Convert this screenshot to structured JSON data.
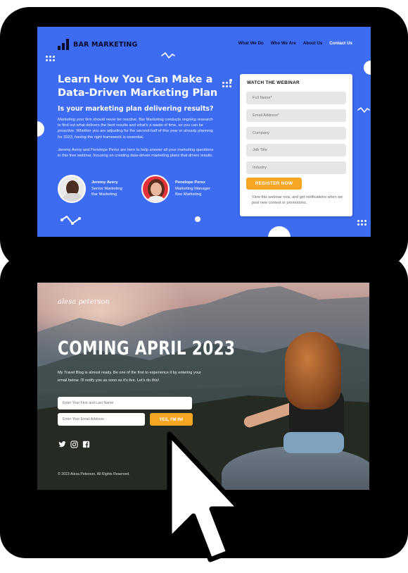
{
  "webinar": {
    "brand": "BAR MARKETING",
    "nav": [
      "What We Do",
      "Who We Are",
      "About Us",
      "Contact Us"
    ],
    "headline": "Learn How You Can Make a Data-Driven Marketing Plan",
    "subheadline": "Is your marketing plan delivering results?",
    "paragraph_1": "Marketing your firm should never be reactive. Bar Marketing conducts ongoing research to find out what delivers the best results and what's a waste of time, so you can be proactive. Whether you are adjusting for the second-half of this year or already planning for 2023, having the right framework is essential.",
    "paragraph_2": "Jeremy Avery and Penelope Perez are here to help answer all your marketing questions in this free webinar, focusing on creating data-driven marketing plans that drives results.",
    "speakers": [
      {
        "name": "Jeremy Avery",
        "role": "Senior Marketing",
        "company": "Bar Marketing"
      },
      {
        "name": "Penelope Perez",
        "role": "Marketing Manager",
        "company": "Bee Marketing"
      }
    ],
    "form": {
      "title": "WATCH THE WEBINAR",
      "placeholders": [
        "Full Name*",
        "Email Address*",
        "Company",
        "Job Title",
        "Industry"
      ],
      "button": "REGISTER NOW",
      "note": "View this webinar now, and get notifications when we post new content or promotions."
    }
  },
  "blog": {
    "brand": "alesa peterson",
    "headline": "COMING APRIL 2023",
    "paragraph": "My Travel Blog is almost ready. Be one of the first to experience it by entering your email below. I'll notify you as soon as it's live. Let's do this!",
    "name_placeholder": "Enter Your First and Last Name",
    "email_placeholder": "Enter Your Email Address",
    "button": "YES, I'M IN!",
    "socials": [
      "twitter-icon",
      "instagram-icon",
      "facebook-icon"
    ],
    "footer": "© 2023 Alexa Peterson. All Rights Reserved."
  },
  "colors": {
    "webinar_bg": "#3d6cf2",
    "accent_orange": "#f6a623",
    "navy": "#0a0a2a"
  }
}
